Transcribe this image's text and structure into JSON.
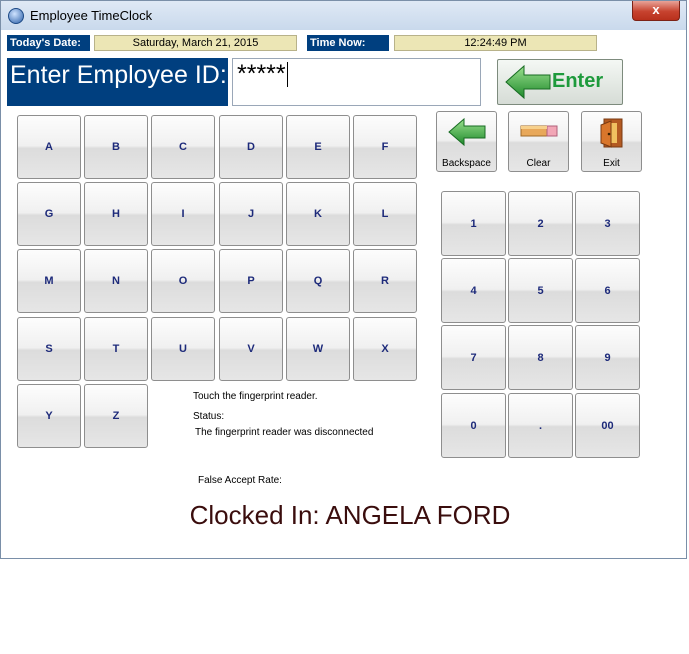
{
  "window": {
    "title": "Employee TimeClock",
    "close_label": "x"
  },
  "header": {
    "date_label": "Today's Date:",
    "date_value": "Saturday, March 21, 2015",
    "time_label": "Time Now:",
    "time_value": "12:24:49 PM"
  },
  "id_entry": {
    "label": "Enter Employee ID:",
    "value": "*****",
    "enter_label": "Enter"
  },
  "letters": [
    "A",
    "B",
    "C",
    "D",
    "E",
    "F",
    "G",
    "H",
    "I",
    "J",
    "K",
    "L",
    "M",
    "N",
    "O",
    "P",
    "Q",
    "R",
    "S",
    "T",
    "U",
    "V",
    "W",
    "X",
    "Y",
    "Z"
  ],
  "numbers": [
    "1",
    "2",
    "3",
    "4",
    "5",
    "6",
    "7",
    "8",
    "9",
    "0",
    ".",
    "00"
  ],
  "tools": {
    "backspace_label": "Backspace",
    "clear_label": "Clear",
    "exit_label": "Exit"
  },
  "fingerprint": {
    "prompt": "Touch the fingerprint reader.",
    "status_label": "Status:",
    "status_text": "The fingerprint reader was disconnected",
    "far_label": "False Accept Rate:"
  },
  "clocked_message": "Clocked In: ANGELA FORD",
  "colors": {
    "label_bg": "#003f7f",
    "value_bg": "#ece6b5",
    "enter_green": "#1e9a3c",
    "key_text": "#1d2a7a"
  }
}
